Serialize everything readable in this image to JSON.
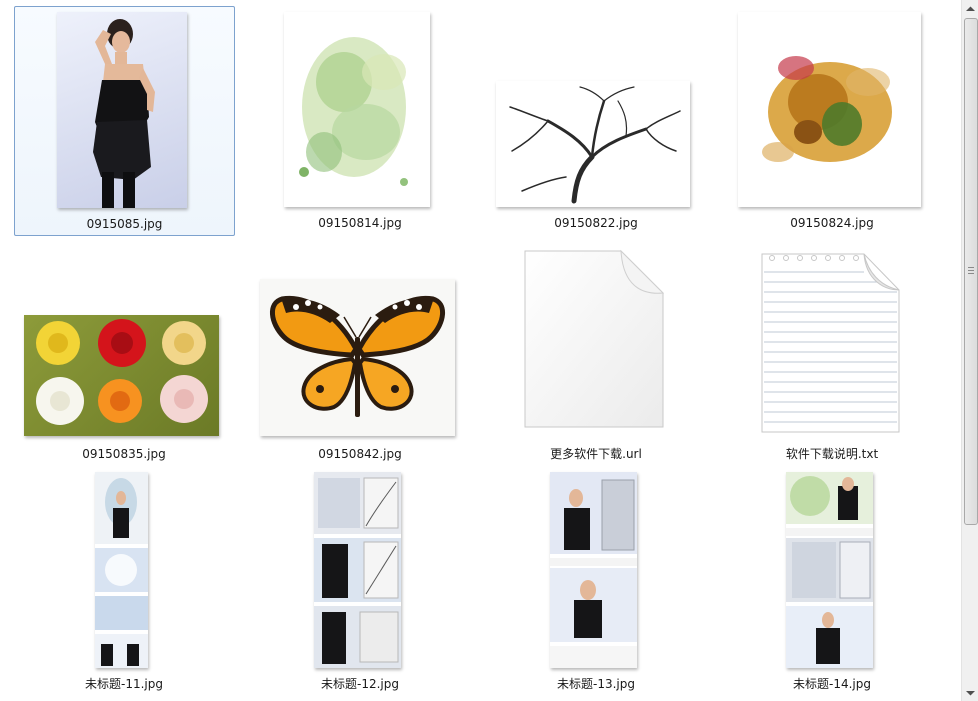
{
  "files": [
    {
      "name": "0915085.jpg",
      "icon": "photo-woman-black-dress",
      "selected": true
    },
    {
      "name": "09150814.jpg",
      "icon": "photo-green-splash"
    },
    {
      "name": "09150822.jpg",
      "icon": "photo-tree-branches"
    },
    {
      "name": "09150824.jpg",
      "icon": "photo-color-explosion"
    },
    {
      "name": "09150835.jpg",
      "icon": "photo-roses"
    },
    {
      "name": "09150842.jpg",
      "icon": "photo-butterfly"
    },
    {
      "name": "更多软件下载.url",
      "icon": "url-file-icon"
    },
    {
      "name": "软件下载说明.txt",
      "icon": "text-file-icon"
    },
    {
      "name": "未标题-11.jpg",
      "icon": "tutorial-thumb"
    },
    {
      "name": "未标题-12.jpg",
      "icon": "tutorial-thumb"
    },
    {
      "name": "未标题-13.jpg",
      "icon": "tutorial-thumb"
    },
    {
      "name": "未标题-14.jpg",
      "icon": "tutorial-thumb"
    }
  ],
  "colors": {
    "selection_border": "#7da2ce",
    "selection_fill": "#eef5fc",
    "scrollbar_track": "#f0f0f0"
  }
}
